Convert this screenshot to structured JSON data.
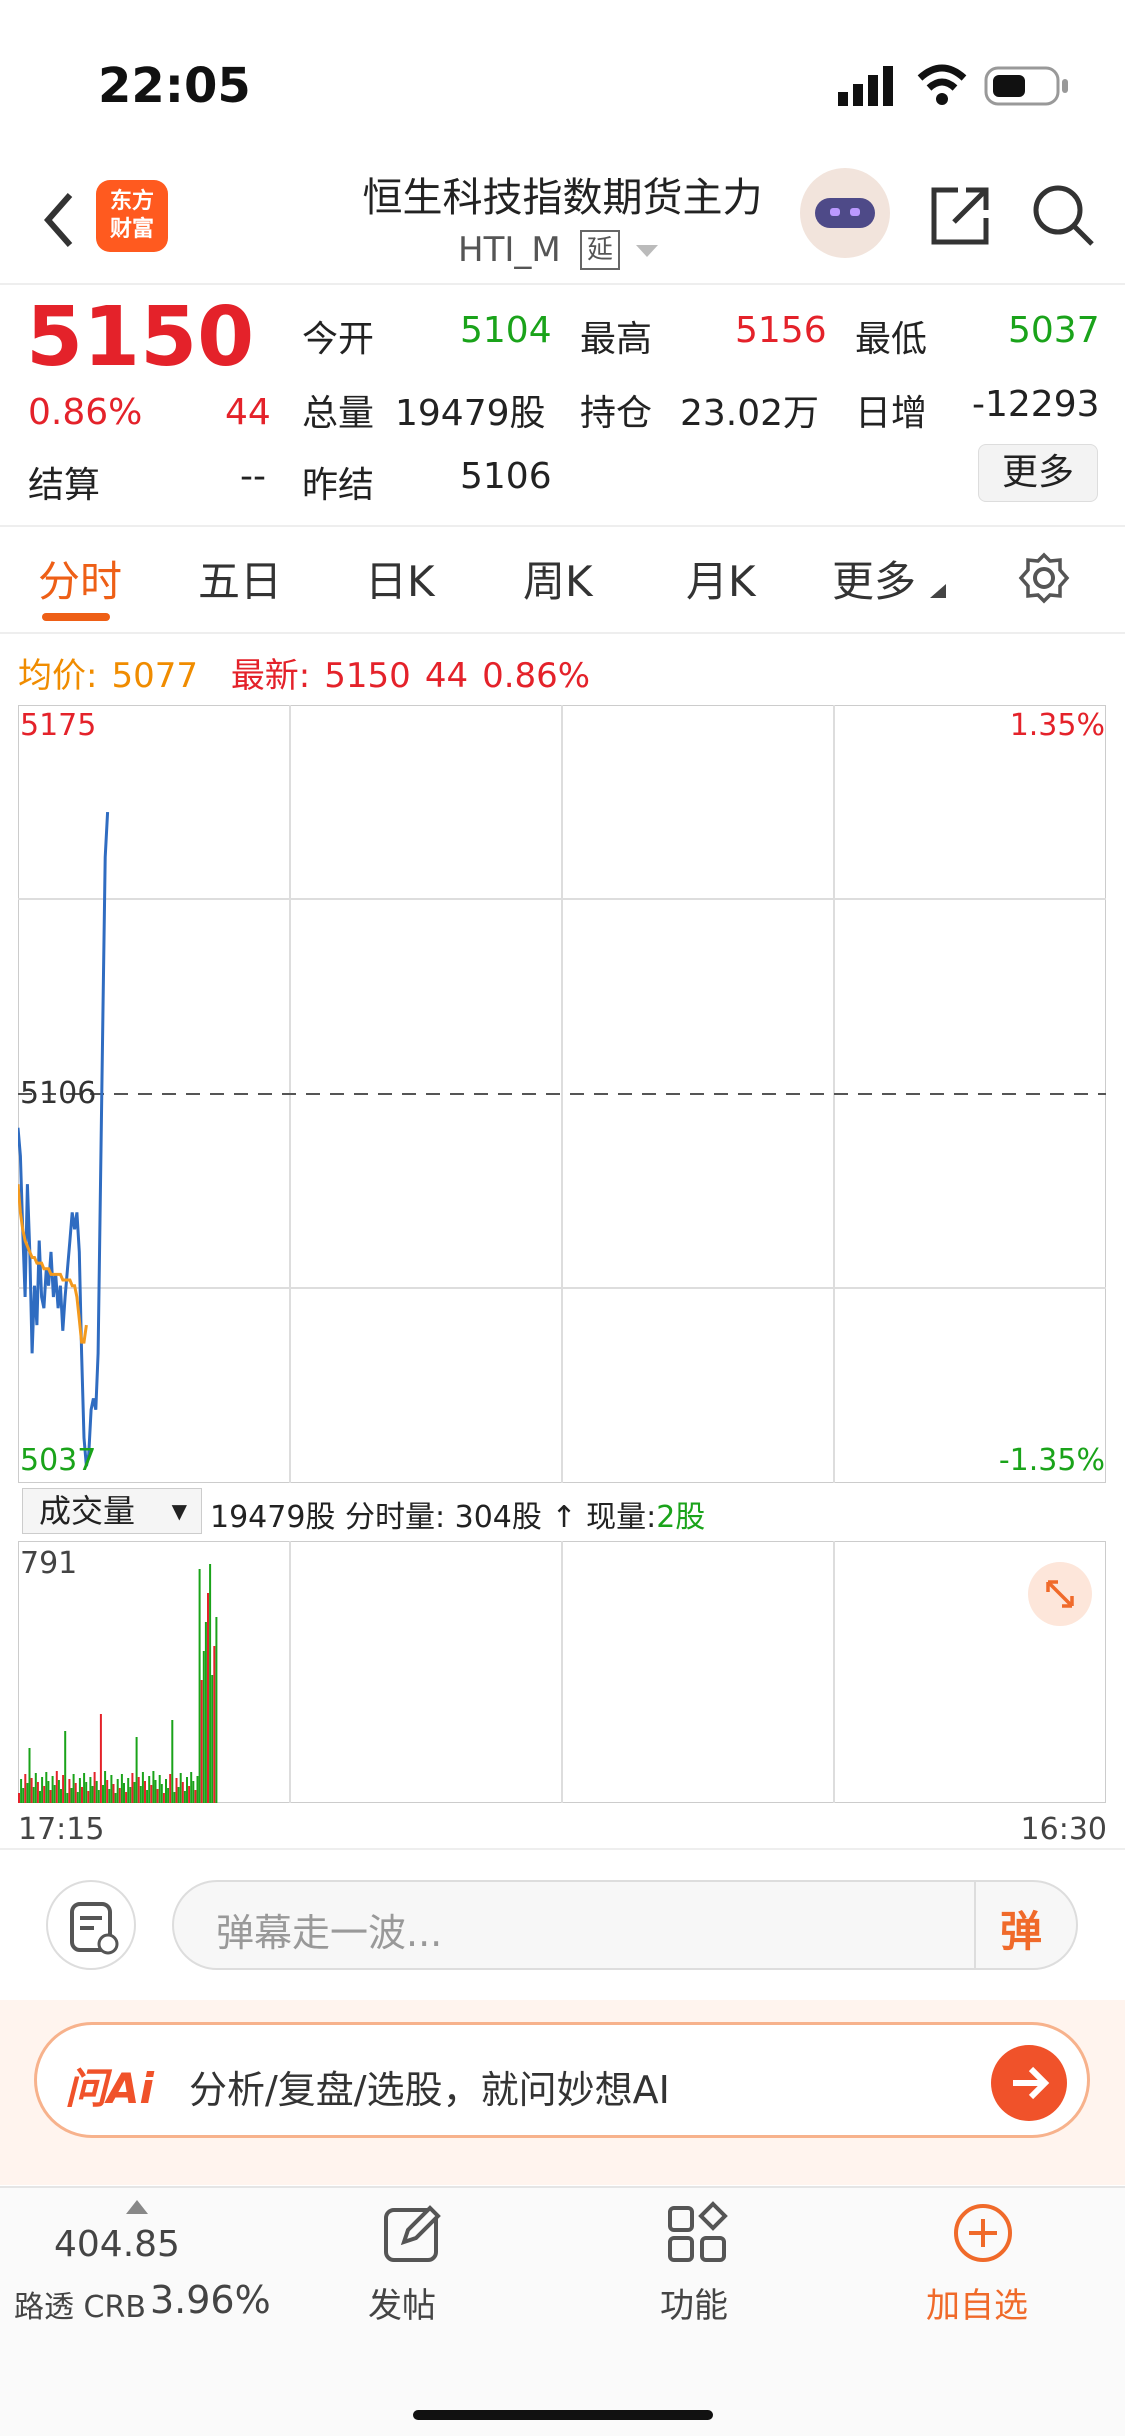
{
  "status": {
    "time": "22:05"
  },
  "header": {
    "logo": "东方财富",
    "title": "恒生科技指数期货主力",
    "code": "HTI_M",
    "delay_badge": "延"
  },
  "quote": {
    "price": "5150",
    "change_pct": "0.86%",
    "change": "44",
    "open_label": "今开",
    "open": "5104",
    "high_label": "最高",
    "high": "5156",
    "low_label": "最低",
    "low": "5037",
    "vol_label": "总量",
    "vol": "19479股",
    "oi_label": "持仓",
    "oi": "23.02万",
    "daily_label": "日增",
    "daily": "-12293",
    "settle_label": "结算",
    "settle": "--",
    "prev_label": "昨结",
    "prev": "5106",
    "more": "更多"
  },
  "tabs": [
    "分时",
    "五日",
    "日K",
    "周K",
    "月K",
    "更多"
  ],
  "legend": {
    "avg_label": "均价:",
    "avg": "5077",
    "latest_label": "最新:",
    "latest": "5150",
    "latest_chg": "44",
    "latest_pct": "0.86%"
  },
  "chart_data": {
    "type": "line",
    "y_top": "5175",
    "y_mid": "5106",
    "y_bottom": "5037",
    "pct_top": "1.35%",
    "pct_bottom": "-1.35%",
    "ylim": [
      5037,
      5175
    ],
    "ref": 5106,
    "series": [
      {
        "color": "#2f6cc1",
        "values": [
          5100,
          5095,
          5082,
          5070,
          5090,
          5078,
          5060,
          5072,
          5065,
          5080,
          5070,
          5068,
          5075,
          5072,
          5078,
          5070,
          5074,
          5068,
          5072,
          5064,
          5070,
          5075,
          5080,
          5085,
          5082,
          5085,
          5078,
          5060,
          5045,
          5040,
          5042,
          5050,
          5052,
          5050,
          5060,
          5090,
          5120,
          5148,
          5156
        ]
      },
      {
        "color": "#f39a1e",
        "values": [
          5090,
          5085,
          5082,
          5080,
          5079,
          5078,
          5077,
          5077,
          5076,
          5076,
          5076,
          5075,
          5075,
          5075,
          5074,
          5074,
          5074,
          5074,
          5074,
          5073,
          5073,
          5073,
          5073,
          5072,
          5072,
          5070,
          5066,
          5062,
          5062,
          5065
        ]
      }
    ],
    "volume": {
      "max_label": "791",
      "x_start": "17:15",
      "x_end": "16:30"
    }
  },
  "vol_bar": {
    "select": "成交量",
    "total": "19479股",
    "seg": "分时量: 304股",
    "now_label": "现量:",
    "now": "2股"
  },
  "danmu": {
    "placeholder": "弹幕走一波...",
    "btn": "弹"
  },
  "ai": {
    "logo": "问Ai",
    "text": "分析/复盘/选股，就问妙想AI"
  },
  "nav": {
    "index_val": "404.85",
    "index_name": "路透 CRB",
    "index_pct": "3.96%",
    "post": "发帖",
    "func": "功能",
    "add": "加自选"
  }
}
